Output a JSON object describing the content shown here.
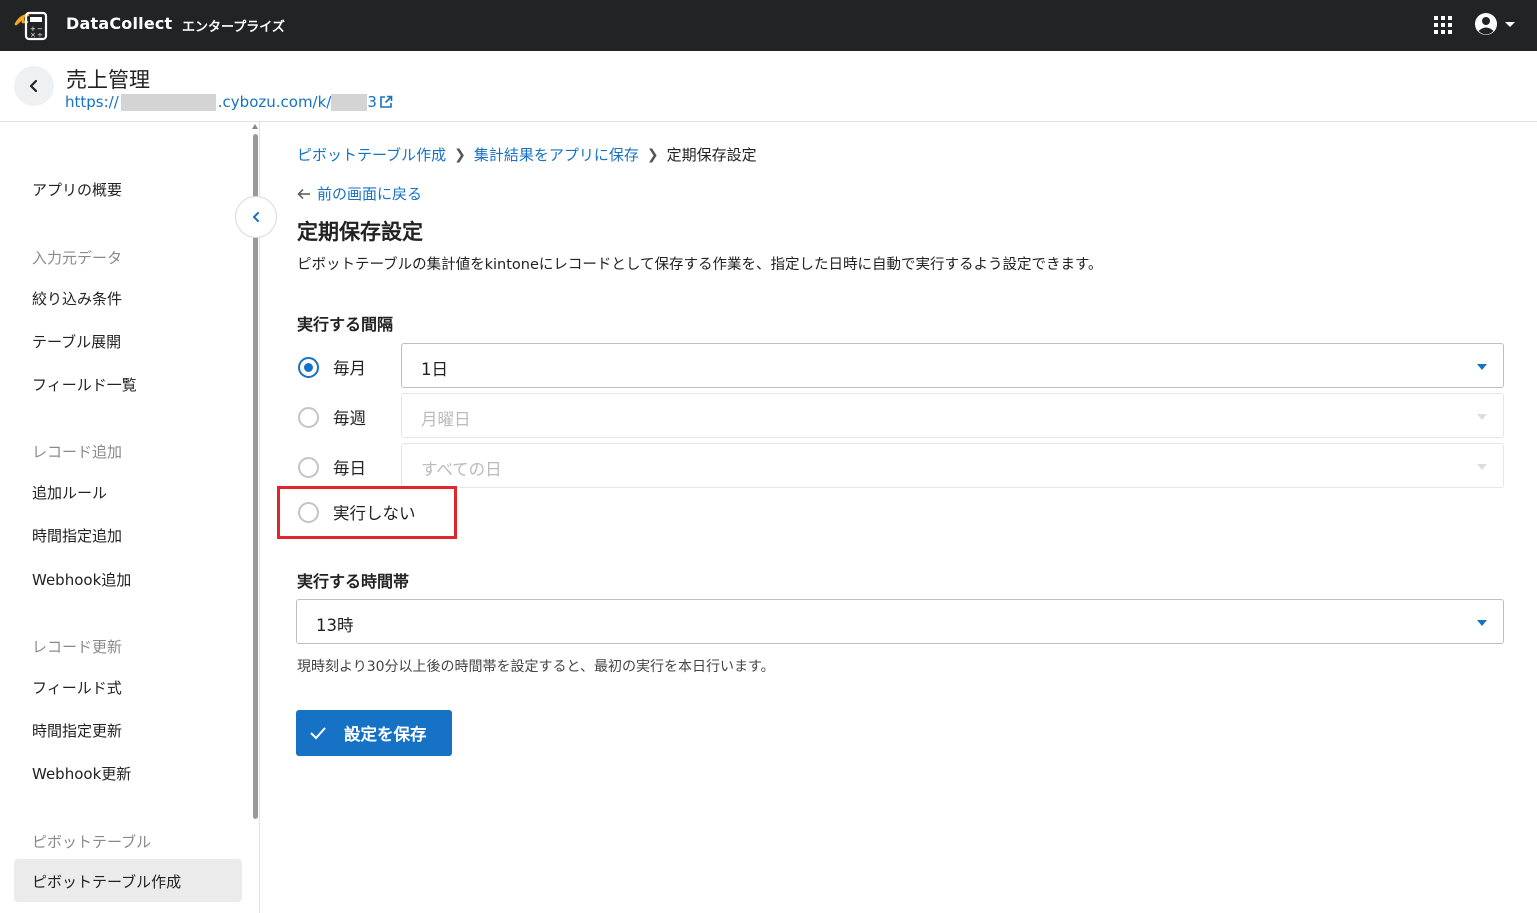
{
  "topbar": {
    "brand": "DataCollect",
    "edition": "エンタープライズ",
    "icons": {
      "logo": "datacollect-logo",
      "apps": "grid-apps-icon",
      "account": "account-circle-icon"
    }
  },
  "app": {
    "title": "売上管理",
    "url_prefix": "https://",
    "url_middle": ".cybozu.com/k/",
    "url_suffix": "3"
  },
  "sidebar": {
    "items": [
      {
        "kind": "item",
        "label": "アプリの概要"
      },
      {
        "kind": "group",
        "label": "入力元データ"
      },
      {
        "kind": "item",
        "label": "絞り込み条件"
      },
      {
        "kind": "item",
        "label": "テーブル展開"
      },
      {
        "kind": "item",
        "label": "フィールド一覧"
      },
      {
        "kind": "group",
        "label": "レコード追加"
      },
      {
        "kind": "item",
        "label": "追加ルール"
      },
      {
        "kind": "item",
        "label": "時間指定追加"
      },
      {
        "kind": "item",
        "label": "Webhook追加"
      },
      {
        "kind": "group",
        "label": "レコード更新"
      },
      {
        "kind": "item",
        "label": "フィールド式"
      },
      {
        "kind": "item",
        "label": "時間指定更新"
      },
      {
        "kind": "item",
        "label": "Webhook更新"
      },
      {
        "kind": "group",
        "label": "ピボットテーブル"
      },
      {
        "kind": "active",
        "label": "ピボットテーブル作成"
      }
    ]
  },
  "breadcrumb": [
    {
      "label": "ピボットテーブル作成",
      "link": true
    },
    {
      "label": "集計結果をアプリに保存",
      "link": true
    },
    {
      "label": "定期保存設定",
      "link": false
    }
  ],
  "back_link": "前の画面に戻る",
  "page": {
    "title": "定期保存設定",
    "description": "ピボットテーブルの集計値をkintoneにレコードとして保存する作業を、指定した日時に自動で実行するよう設定できます。"
  },
  "interval": {
    "heading": "実行する間隔",
    "options": [
      {
        "label": "毎月",
        "selected": true,
        "select_value": "1日",
        "select_enabled": true
      },
      {
        "label": "毎週",
        "selected": false,
        "select_value": "月曜日",
        "select_enabled": false
      },
      {
        "label": "毎日",
        "selected": false,
        "select_value": "すべての日",
        "select_enabled": false
      },
      {
        "label": "実行しない",
        "selected": false
      }
    ]
  },
  "time": {
    "heading": "実行する時間帯",
    "value": "13時",
    "hint": "現時刻より30分以上後の時間帯を設定すると、最初の実行を本日行います。"
  },
  "save_button": "設定を保存",
  "colors": {
    "accent": "#1672c4",
    "topbar": "#222324",
    "highlight": "#e0262a"
  }
}
